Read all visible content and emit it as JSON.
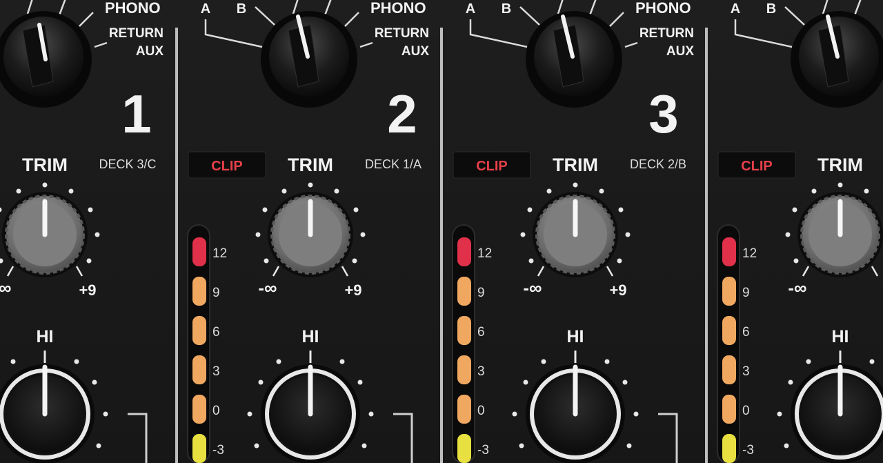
{
  "channels": [
    {
      "number": "1",
      "deck": "DECK 3/C",
      "clip": ""
    },
    {
      "number": "2",
      "deck": "DECK 1/A",
      "clip": "CLIP"
    },
    {
      "number": "3",
      "deck": "DECK 2/B",
      "clip": "CLIP"
    },
    {
      "number": "",
      "deck": "",
      "clip": "CLIP"
    }
  ],
  "input_selector": {
    "a": "A",
    "b": "B",
    "phono": "PHONO",
    "return": "RETURN",
    "aux": "AUX"
  },
  "trim": {
    "label": "TRIM",
    "min": "-∞",
    "max": "+9"
  },
  "eq": {
    "label": "HI"
  },
  "level_meter": {
    "labels": [
      "12",
      "9",
      "6",
      "3",
      "0",
      "-3"
    ],
    "segment_colors": [
      "#e0304a",
      "#f0a860",
      "#f0a860",
      "#f0a860",
      "#f0a860",
      "#e8e040"
    ]
  },
  "colors": {
    "panel": "#1c1c1c",
    "divider": "#bdbdbd",
    "clip_text": "#e8404a"
  }
}
